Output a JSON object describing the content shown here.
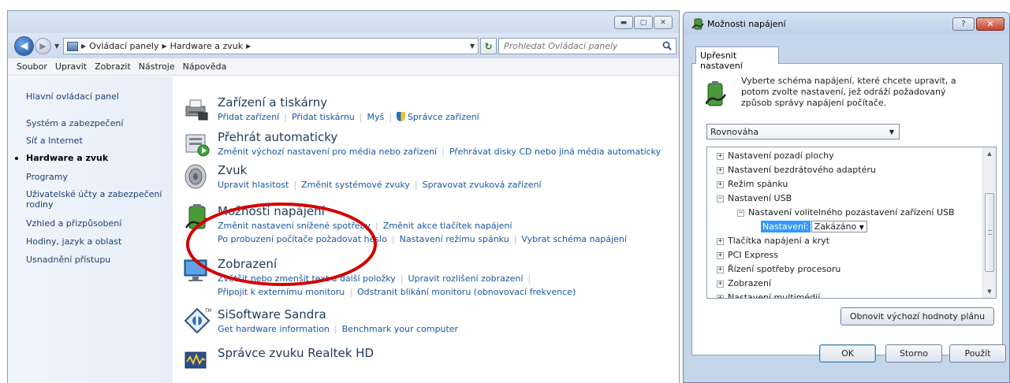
{
  "control_panel": {
    "address": {
      "crumbs": [
        "Ovládací panely",
        "Hardware a zvuk"
      ]
    },
    "search": {
      "placeholder": "Prohledat Ovládací panely"
    },
    "menu": [
      "Soubor",
      "Upravit",
      "Zobrazit",
      "Nástroje",
      "Nápověda"
    ],
    "nav": {
      "home": "Hlavní ovládací panel",
      "items": [
        "Systém a zabezpečení",
        "Síť a Internet",
        "Hardware a zvuk",
        "Programy",
        "Uživatelské účty a zabezpečení rodiny",
        "Vzhled a přizpůsobení",
        "Hodiny, jazyk a oblast",
        "Usnadnění přístupu"
      ],
      "current": "Hardware a zvuk"
    },
    "categories": {
      "devices": {
        "title": "Zařízení a tiskárny",
        "links": [
          "Přidat zařízení",
          "Přidat tiskárnu",
          "Myš",
          "Správce zařízení"
        ]
      },
      "autoplay": {
        "title": "Přehrát automaticky",
        "links": [
          "Změnit výchozí nastavení pro média nebo zařízení",
          "Přehrávat disky CD nebo jiná média automaticky"
        ]
      },
      "sound": {
        "title": "Zvuk",
        "links": [
          "Upravit hlasitost",
          "Změnit systémové zvuky",
          "Spravovat zvuková zařízení"
        ]
      },
      "power": {
        "title": "Možnosti napájení",
        "links_row1": [
          "Změnit nastavení snížené spotřeby",
          "Změnit akce tlačítek napájení"
        ],
        "links_row2": [
          "Po probuzení počítače požadovat heslo",
          "Nastavení režimu spánku",
          "Vybrat schéma napájení"
        ]
      },
      "display": {
        "title": "Zobrazení",
        "links_row1": [
          "Zvětšit nebo zmenšit text a další položky",
          "Upravit rozlišení zobrazení"
        ],
        "links_row2": [
          "Připojit k externímu monitoru",
          "Odstranit blikání monitoru (obnovovací frekvence)"
        ]
      },
      "sandra": {
        "title": "SiSoftware Sandra",
        "links": [
          "Get hardware information",
          "Benchmark your computer"
        ]
      },
      "realtek": {
        "title": "Správce zvuku Realtek HD"
      }
    }
  },
  "power_dialog": {
    "title": "Možnosti napájení",
    "help_label": "?",
    "close_label": "✕",
    "tab": "Upřesnit nastavení",
    "instructions": "Vyberte schéma napájení, které chcete upravit, a potom zvolte nastavení, jež odráží požadovaný způsob správy napájení počítače.",
    "scheme": "Rovnováha",
    "tree": [
      "Nastavení pozadí plochy",
      "Nastavení bezdrátového adaptéru",
      "Režim spánku",
      "Nastavení USB",
      "Nastavení volitelného pozastavení zařízení USB",
      "Nastavení:",
      "Zakázáno",
      "Tlačítka napájení a kryt",
      "PCI Express",
      "Řízení spotřeby procesoru",
      "Zobrazení",
      "Nastavení multimédií"
    ],
    "restore_label": "Obnovit výchozí hodnoty plánu",
    "buttons": {
      "ok": "OK",
      "cancel": "Storno",
      "apply": "Použít"
    }
  },
  "colors": {
    "link": "#1a56a3",
    "category_title": "#1e395b",
    "annotation_ellipse": "#d40000",
    "selection": "#3399ff"
  }
}
